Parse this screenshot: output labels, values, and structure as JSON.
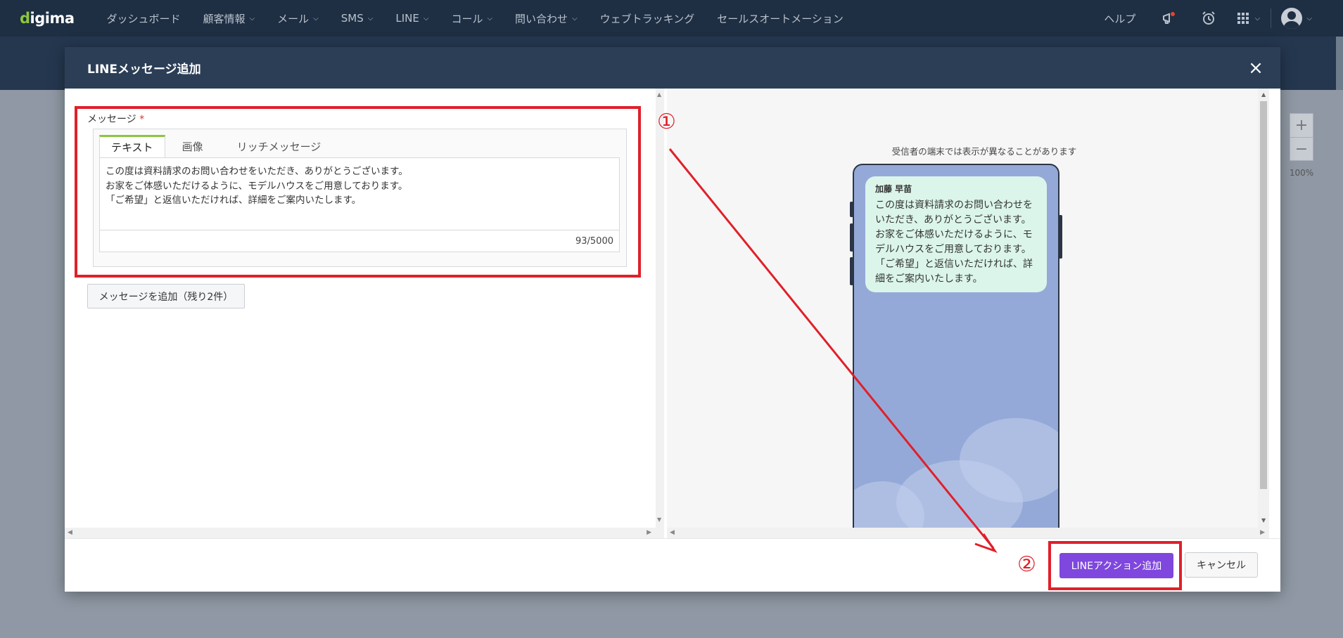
{
  "app": {
    "logo": "digima",
    "nav": [
      {
        "label": "ダッシュボード",
        "has_dropdown": false
      },
      {
        "label": "顧客情報",
        "has_dropdown": true
      },
      {
        "label": "メール",
        "has_dropdown": true
      },
      {
        "label": "SMS",
        "has_dropdown": true
      },
      {
        "label": "LINE",
        "has_dropdown": true
      },
      {
        "label": "コール",
        "has_dropdown": true
      },
      {
        "label": "問い合わせ",
        "has_dropdown": true
      },
      {
        "label": "ウェブトラッキング",
        "has_dropdown": false
      },
      {
        "label": "セールスオートメーション",
        "has_dropdown": false
      }
    ],
    "help_label": "ヘルプ",
    "icons": [
      "megaphone-icon",
      "alarm-clock-icon",
      "apps-grid-icon",
      "user-avatar-icon"
    ]
  },
  "canvas": {
    "zoom_in": "+",
    "zoom_out": "−",
    "zoom_level": "100%"
  },
  "modal": {
    "title": "LINEメッセージ追加",
    "close": "×",
    "message_label": "メッセージ",
    "required_mark": "*",
    "tabs": [
      {
        "label": "テキスト",
        "active": true
      },
      {
        "label": "画像",
        "active": false
      },
      {
        "label": "リッチメッセージ",
        "active": false
      }
    ],
    "message_lines": [
      "この度は資料請求のお問い合わせをいただき、ありがとうございます。",
      "お家をご体感いただけるように、モデルハウスをご用意しております。",
      "「ご希望」と返信いただければ、詳細をご案内いたします。"
    ],
    "char_count": "93/5000",
    "add_message_button": "メッセージを追加（残り2件）",
    "preview_note": "受信者の端末では表示が異なることがあります",
    "preview_sender": "加藤 早苗",
    "preview_lines": [
      "この度は資料請求のお問い合わせを",
      "いただき、ありがとうございます。",
      "お家をご体感いただけるように、モ",
      "デルハウスをご用意しております。",
      "「ご希望」と返信いただければ、詳",
      "細をご案内いたします。"
    ],
    "primary_button": "LINEアクション追加",
    "cancel_button": "キャンセル"
  },
  "annotations": {
    "step1": "①",
    "step2": "②",
    "color": "#e0202a"
  },
  "colors": {
    "nav_bg": "#1e2e43",
    "modal_header_bg": "#2b3e56",
    "primary": "#7f47dd",
    "tab_accent": "#8cc63f",
    "bubble_bg": "#dbf5ea",
    "phone_bg": "#95a9d8"
  }
}
